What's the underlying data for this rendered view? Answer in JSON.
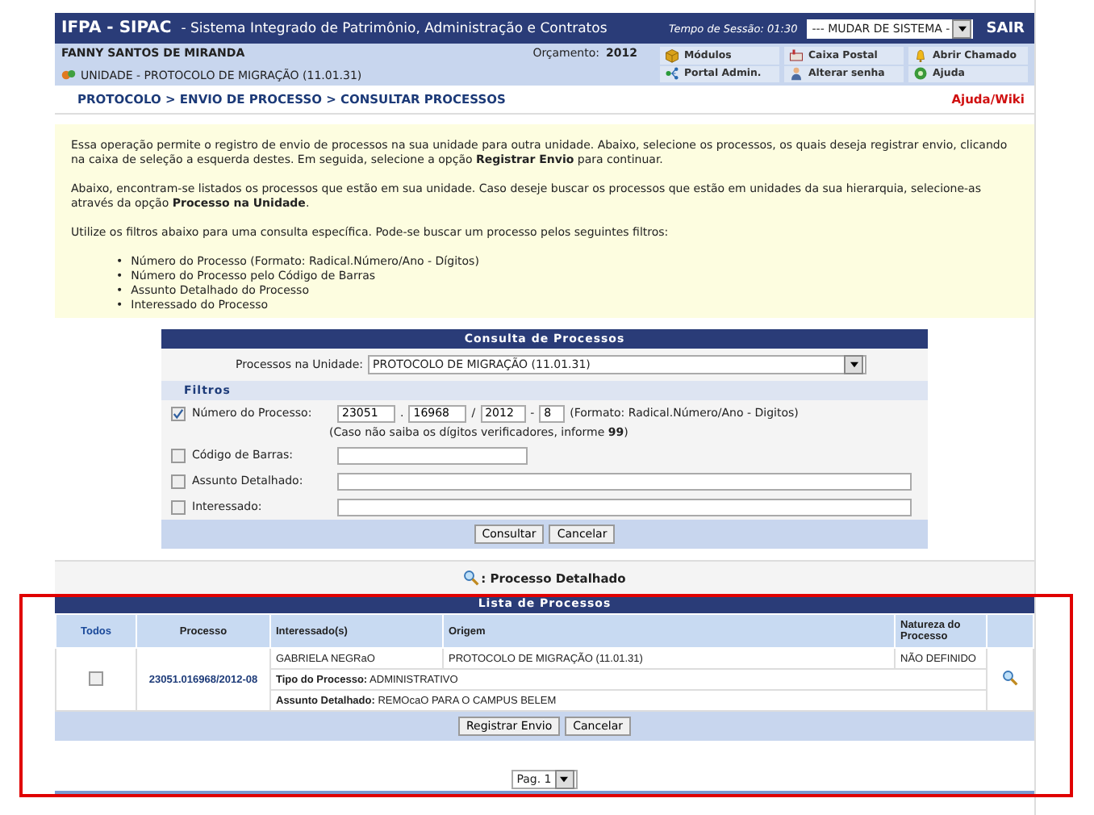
{
  "header": {
    "system_title": "IFPA - SIPAC",
    "system_subtitle": "- Sistema Integrado de Patrimônio, Administração e Contratos",
    "session": "Tempo de Sessão: 01:30",
    "system_select": "--- MUDAR DE SISTEMA -",
    "logout": "SAIR"
  },
  "user": {
    "name": "FANNY SANTOS DE MIRANDA",
    "unit": "UNIDADE - PROTOCOLO DE MIGRAÇÃO (11.01.31)",
    "budget_label": "Orçamento:",
    "budget_year": "2012"
  },
  "shortcuts": [
    {
      "label": "Módulos"
    },
    {
      "label": "Caixa Postal"
    },
    {
      "label": "Abrir Chamado"
    },
    {
      "label": "Portal Admin."
    },
    {
      "label": "Alterar senha"
    },
    {
      "label": "Ajuda"
    }
  ],
  "breadcrumb": "PROTOCOLO > ENVIO DE PROCESSO > CONSULTAR PROCESSOS",
  "help_link": "Ajuda/Wiki",
  "info": {
    "paragraphs": [
      "Essa operação permite o registro de envio de processos na sua unidade para outra unidade. Abaixo, selecione os processos, os quais deseja registrar envio, clicando na caixa de seleção a esquerda destes. Em seguida, selecione a opção **Registrar Envio** para continuar.",
      "Abaixo, encontram-se listados os processos que estão em sua unidade. Caso deseje buscar os processos que estão em unidades da sua hierarquia, selecione-as através da opção **Processo na Unidade**.",
      "Utilize os filtros abaixo para uma consulta específica. Pode-se buscar um processo pelos seguintes filtros:"
    ],
    "marker": "•",
    "filters": [
      "Número do Processo (Formato: Radical.Número/Ano - Dígitos)",
      "Número do Processo pelo Código de Barras",
      "Assunto Detalhado do Processo",
      "Interessado do Processo"
    ]
  },
  "search_form": {
    "title": "Consulta de Processos",
    "unit_label": "Processos na Unidade:",
    "unit_value": "PROTOCOLO DE MIGRAÇÃO (11.01.31)",
    "filters_heading": "Filtros",
    "filters": [
      {
        "kind": "process_number",
        "label": "Número do Processo:",
        "checked": true,
        "parts": [
          "23051",
          "16968",
          "2012",
          "8"
        ],
        "separators": [
          ".",
          "/",
          "-"
        ],
        "hint": "(Formato: Radical.Número/Ano - Digitos)",
        "note": "(Caso não saiba os dígitos verificadores, informe **99**)"
      },
      {
        "kind": "short_text",
        "label": "Código de Barras:",
        "checked": false
      },
      {
        "kind": "text",
        "label": "Assunto Detalhado:",
        "checked": false
      },
      {
        "kind": "text",
        "label": "Interessado:",
        "checked": false
      }
    ],
    "buttons": [
      "Consultar",
      "Cancelar"
    ]
  },
  "legend": ": Processo Detalhado",
  "process_list": {
    "title": "Lista de Processos",
    "columns": [
      "Todos",
      "Processo",
      "Interessado(s)",
      "Origem",
      "Natureza do Processo"
    ],
    "rows": [
      {
        "checked": false,
        "process": "23051.016968/2012-08",
        "interested": "GABRIELA NEGRaO",
        "origin": "PROTOCOLO DE MIGRAÇÃO (11.01.31)",
        "nature": "NÃO DEFINIDO",
        "type_label": "Tipo do Processo:",
        "type": "ADMINISTRATIVO",
        "subject_label": "Assunto Detalhado:",
        "subject": "REMOcaO PARA O CAMPUS BELEM"
      }
    ],
    "buttons": [
      "Registrar Envio",
      "Cancelar"
    ]
  },
  "pagination": "Pag. 1"
}
